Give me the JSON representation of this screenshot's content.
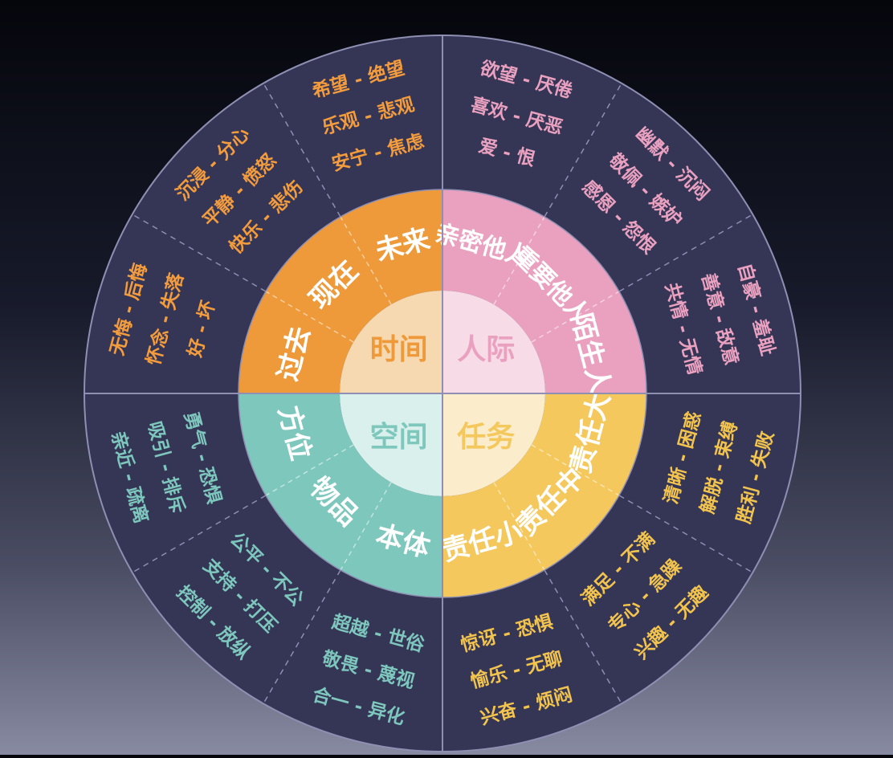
{
  "diagram": {
    "quadrants": [
      {
        "id": "time",
        "center_label": "时间",
        "color": "#ef9a3a",
        "hub_color": "#f6d9b0",
        "text_color": "#f39c3d",
        "subdivisions": [
          "过去",
          "现在",
          "未来"
        ],
        "emotion_pairs": [
          [
            "无悔 - 后悔",
            "怀念 - 失落",
            "好 - 坏"
          ],
          [
            "沉浸 - 分心",
            "平静 - 愤怒",
            "快乐 - 悲伤"
          ],
          [
            "希望 - 绝望",
            "乐观 - 悲观",
            "安宁 - 焦虑"
          ]
        ]
      },
      {
        "id": "interpersonal",
        "center_label": "人际",
        "color": "#eaa1c0",
        "hub_color": "#f7dbe6",
        "text_color": "#eaa1c0",
        "subdivisions": [
          "亲密他人",
          "重要他人",
          "陌生人"
        ],
        "emotion_pairs": [
          [
            "欲望 - 厌倦",
            "喜欢 - 厌恶",
            "爱 - 恨"
          ],
          [
            "幽默 - 沉闷",
            "敬佩 - 嫉妒",
            "感恩 - 怨恨"
          ],
          [
            "自豪 - 羞耻",
            "善意 - 敌意",
            "共情 - 无情"
          ]
        ]
      },
      {
        "id": "task",
        "center_label": "任务",
        "color": "#f4c85c",
        "hub_color": "#fbeccb",
        "text_color": "#f2c44e",
        "subdivisions": [
          "责任大",
          "责任中",
          "责任小"
        ],
        "emotion_pairs": [
          [
            "清晰 - 困惑",
            "解脱 - 束缚",
            "胜利 - 失败"
          ],
          [
            "满足 - 不满",
            "专心 - 急躁",
            "兴趣 - 无趣"
          ],
          [
            "惊讶 - 恐惧",
            "愉乐 - 无聊",
            "兴奋 - 烦闷"
          ]
        ]
      },
      {
        "id": "space",
        "center_label": "空间",
        "color": "#7dc7bd",
        "hub_color": "#d9f0ec",
        "text_color": "#7dc7bd",
        "subdivisions": [
          "本体",
          "物品",
          "方位"
        ],
        "emotion_pairs": [
          [
            "超越 - 世俗",
            "敬畏 - 蔑视",
            "合一 - 异化"
          ],
          [
            "公平 - 不公",
            "支持 - 打压",
            "控制 - 放纵"
          ],
          [
            "勇气 - 恐惧",
            "吸引 - 排斥",
            "亲近 - 疏离"
          ]
        ]
      }
    ],
    "ring_color": "#353556",
    "ring_border_color": "#8e8fb2"
  }
}
